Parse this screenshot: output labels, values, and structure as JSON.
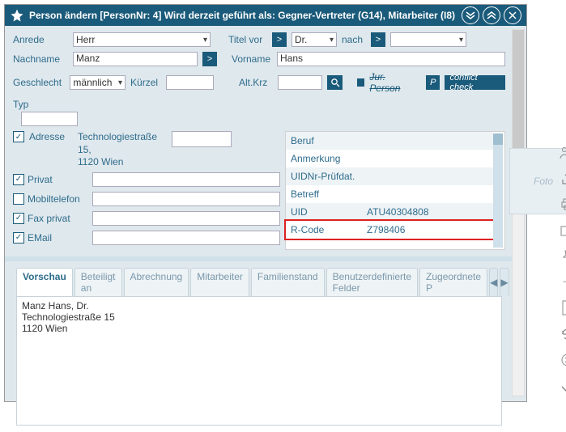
{
  "title": "Person ändern  [PersonNr: 4] Wird derzeit geführt als: Gegner-Vertreter (G14), Mitarbeiter (I8)",
  "labels": {
    "anrede": "Anrede",
    "titelvor": "Titel vor",
    "nach": "nach",
    "nachname": "Nachname",
    "vorname": "Vorname",
    "geschlecht": "Geschlecht",
    "kuerzel": "Kürzel",
    "altkrz": "Alt.Krz",
    "jurperson": "Jur. Person",
    "conflict": "conflict check",
    "typ": "Typ",
    "adresse": "Adresse",
    "privat": "Privat",
    "mobil": "Mobiltelefon",
    "fax": "Fax privat",
    "email": "EMail",
    "foto": "Foto",
    "p": "P",
    "gt": ">"
  },
  "values": {
    "anrede": "Herr",
    "titelvor": "Dr.",
    "nach": "",
    "nachname": "Manz",
    "vorname": "Hans",
    "geschlecht": "männlich",
    "addr1": "Technologiestraße",
    "addr2": "15,",
    "addr3": "1120 Wien"
  },
  "checks": {
    "adresse": true,
    "privat": true,
    "mobil": false,
    "fax": true,
    "email": true
  },
  "right": [
    {
      "lbl": "Beruf",
      "val": ""
    },
    {
      "lbl": "Anmerkung",
      "val": ""
    },
    {
      "lbl": "UIDNr-Prüfdat.",
      "val": ""
    },
    {
      "lbl": "Betreff",
      "val": ""
    },
    {
      "lbl": "UID",
      "val": "ATU40304808"
    },
    {
      "lbl": "R-Code",
      "val": "Z798406",
      "hl": true
    }
  ],
  "tabs": [
    "Vorschau",
    "Beteiligt an",
    "Abrechnung",
    "Mitarbeiter",
    "Familienstand",
    "Benutzerdefinierte Felder",
    "Zugeordnete P"
  ],
  "preview": {
    "l1": "Manz Hans, Dr.",
    "l2": "Technologiestraße 15",
    "l3": "1120 Wien"
  }
}
